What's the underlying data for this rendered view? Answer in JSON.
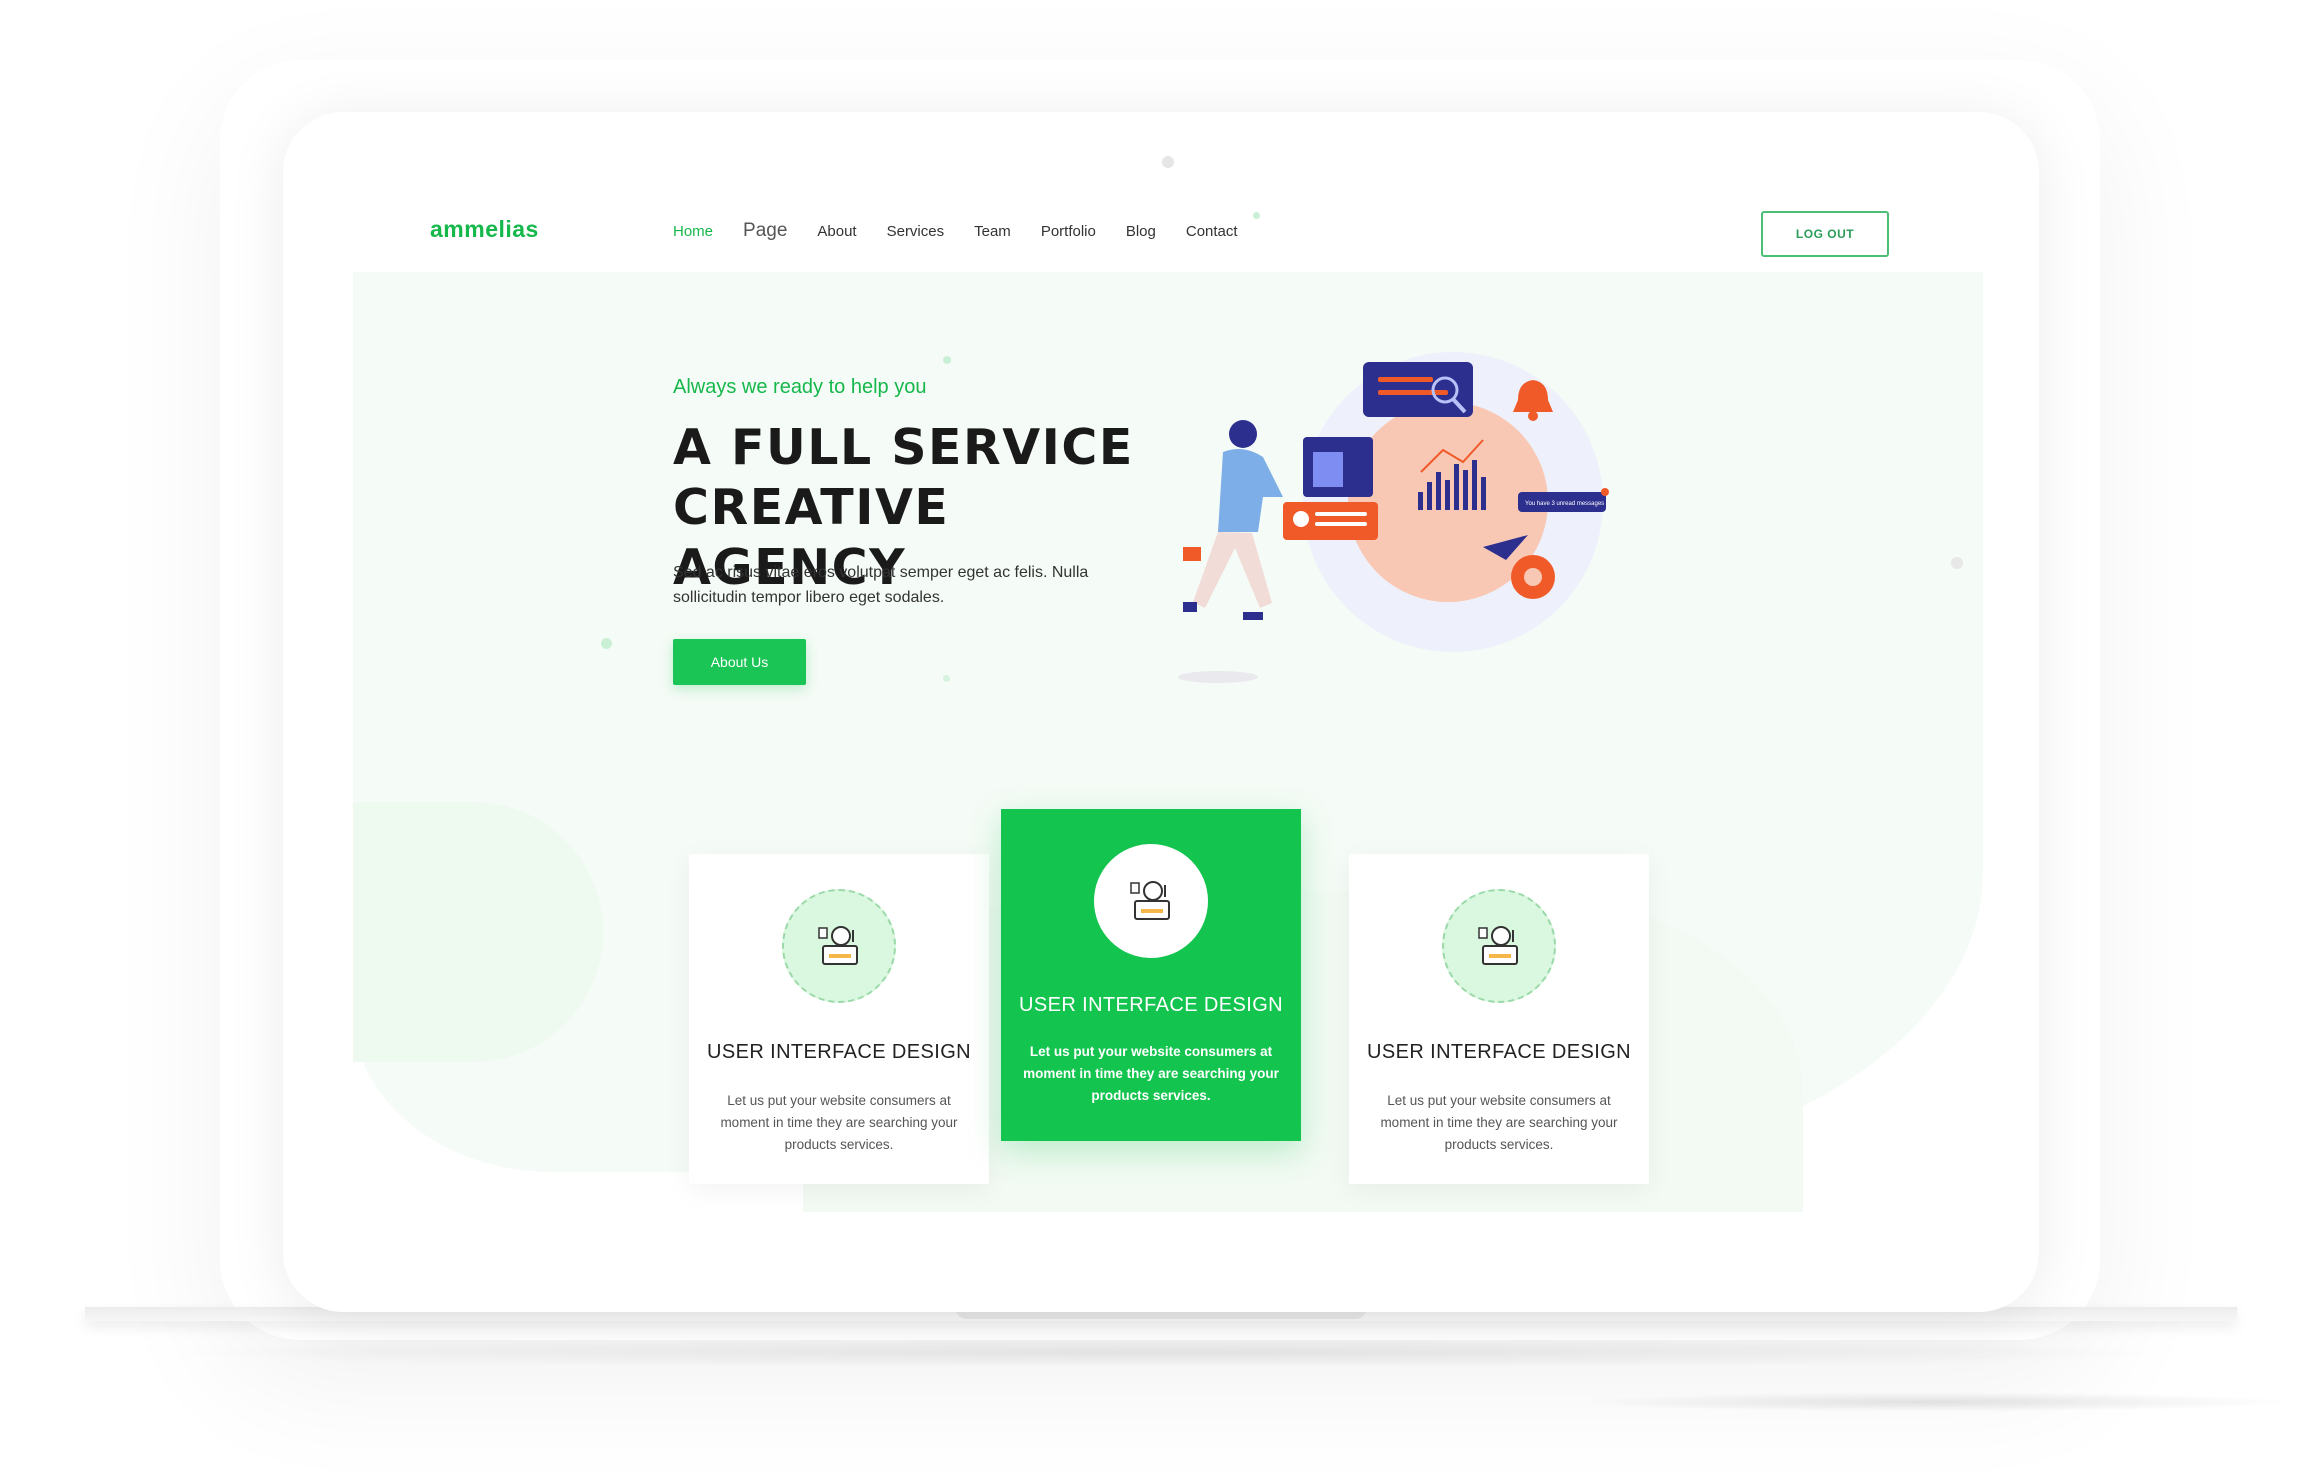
{
  "brand": {
    "logo": "ammelias"
  },
  "nav": {
    "items": [
      {
        "label": "Home",
        "active": true
      },
      {
        "label": "Page"
      },
      {
        "label": "About"
      },
      {
        "label": "Services"
      },
      {
        "label": "Team"
      },
      {
        "label": "Portfolio"
      },
      {
        "label": "Blog"
      },
      {
        "label": "Contact"
      }
    ],
    "logout_label": "LOG OUT"
  },
  "hero": {
    "tagline": "Always we ready to help you",
    "title_line1": "A FULL SERVICE",
    "title_line2": "CREATIVE AGENCY",
    "description": "Sed ac risus vitae eros volutpat semper eget ac felis. Nulla sollicitudin tempor libero eget sodales.",
    "cta_label": "About Us",
    "illustration_message": "You have 3 unread messages"
  },
  "services": [
    {
      "title": "USER INTERFACE DESIGN",
      "description": "Let us put your website consumers at moment in time they are searching your products services.",
      "featured": false
    },
    {
      "title": "USER INTERFACE DESIGN",
      "description": "Let us put your website consumers at moment in time they are searching your products services.",
      "featured": true
    },
    {
      "title": "USER INTERFACE DESIGN",
      "description": "Let us put your website consumers at moment in time they are searching your products services.",
      "featured": false
    }
  ],
  "colors": {
    "accent": "#16b84c",
    "featured_card": "#13c44f",
    "illustration_navy": "#2d2f8f",
    "illustration_orange": "#f05a28",
    "illustration_peach": "#f9c8b4"
  },
  "icons": {
    "service": "design-tool-icon"
  }
}
